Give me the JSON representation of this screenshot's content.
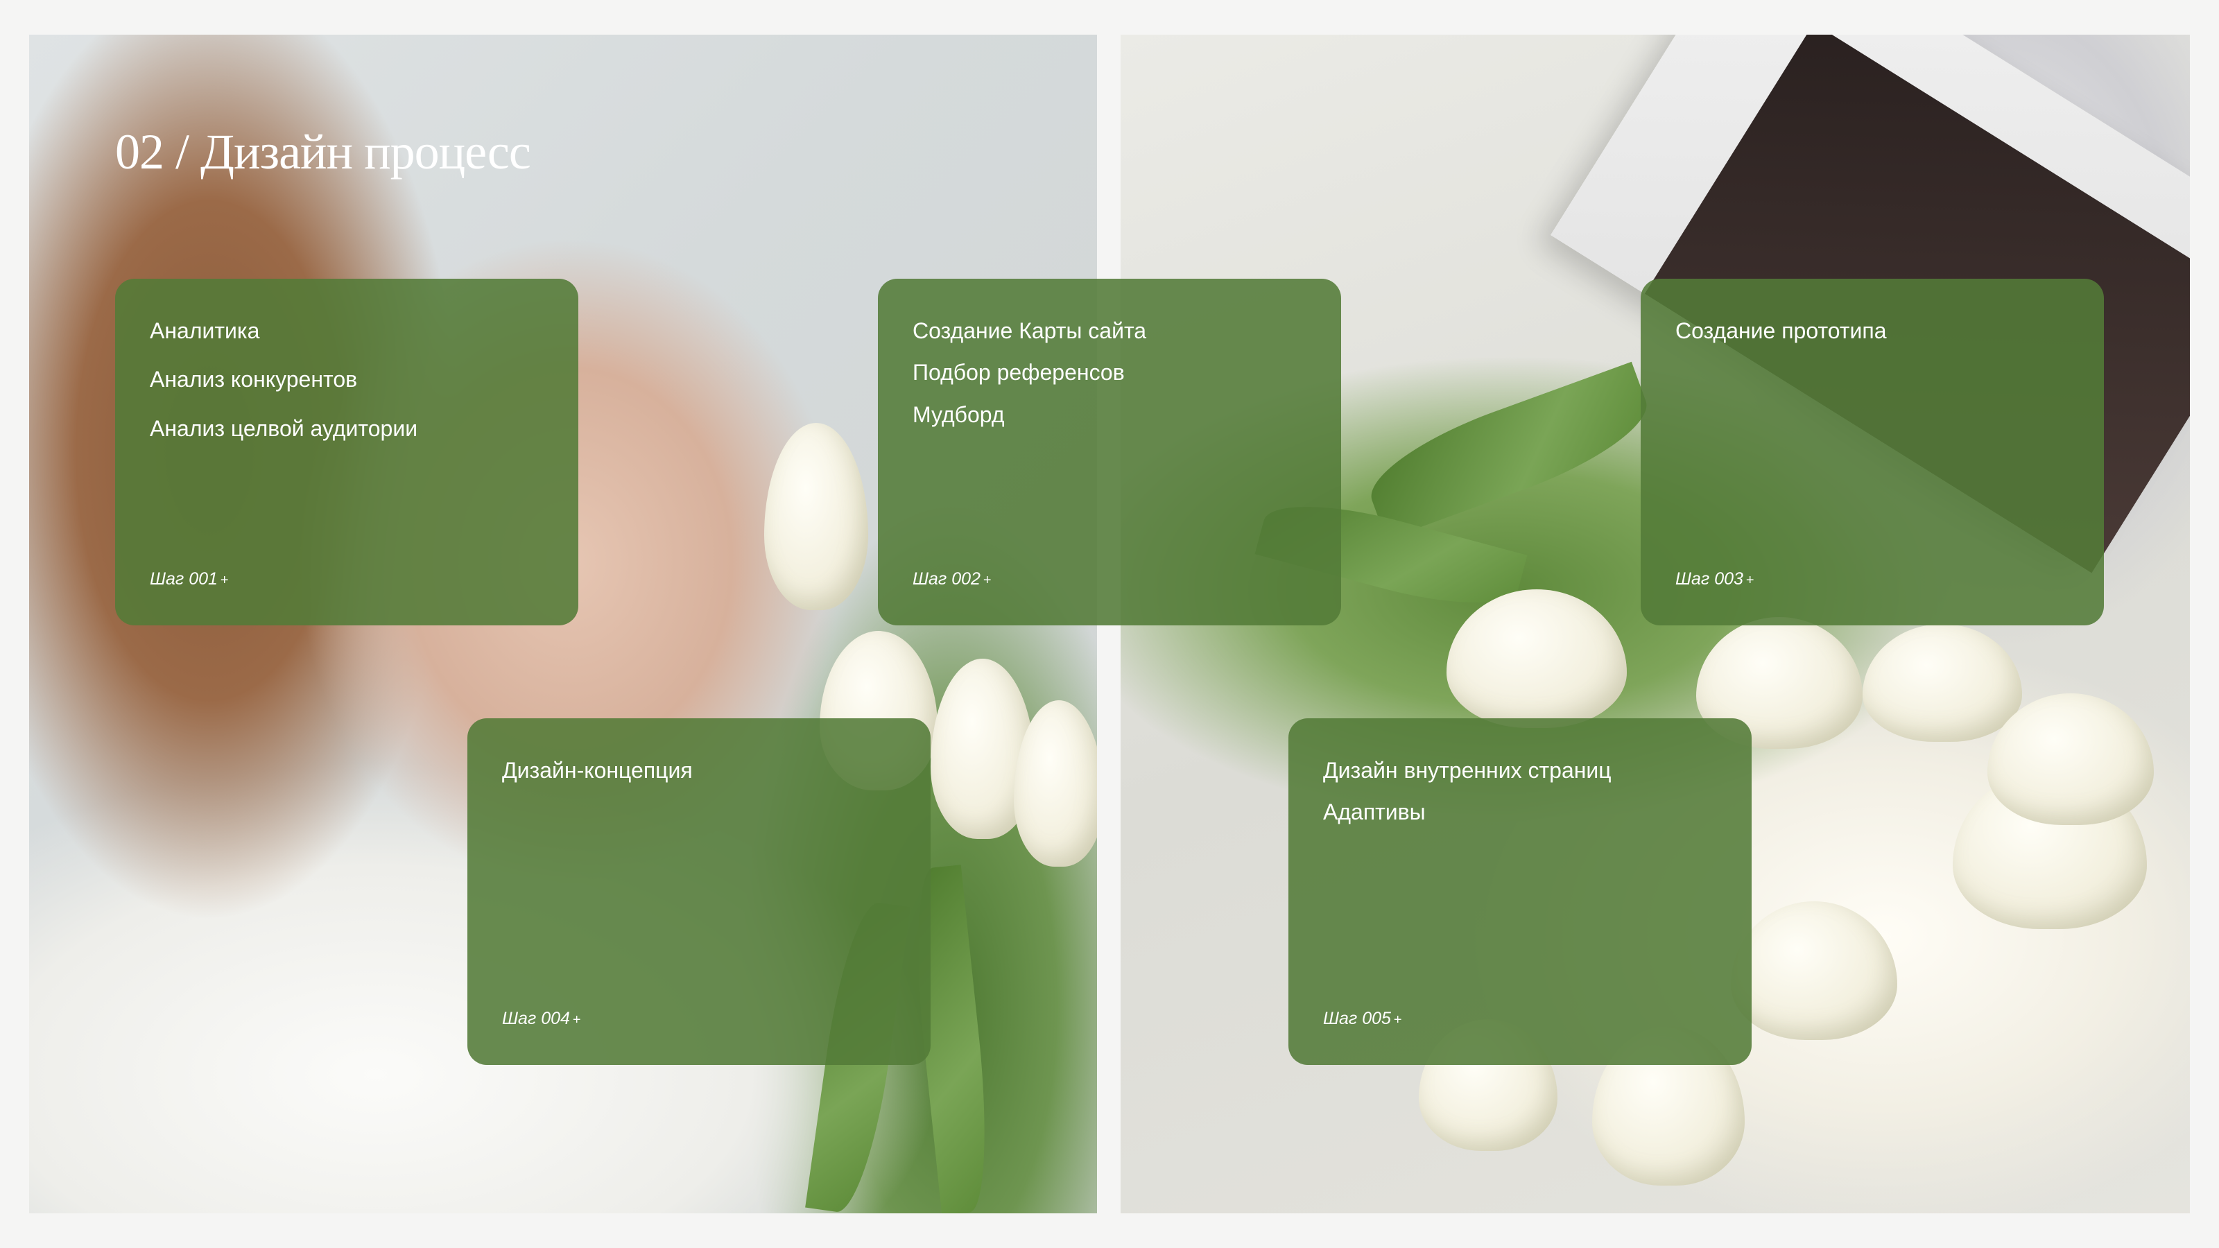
{
  "heading": {
    "title": "02 / Дизайн процесс"
  },
  "colors": {
    "card_background": "#537b38",
    "text": "#ffffff",
    "page_background": "#f5f5f4"
  },
  "images": {
    "left": "photo of woman with white tulips",
    "right": "white tulips on satin fabric with magazine"
  },
  "steps": [
    {
      "items": [
        "Аналитика",
        "Анализ конкурентов",
        "Анализ целвой аудитории"
      ],
      "label": "Шаг 001"
    },
    {
      "items": [
        "Создание Карты сайта",
        "Подбор референсов",
        "Мудборд"
      ],
      "label": "Шаг 002"
    },
    {
      "items": [
        "Создание прототипа"
      ],
      "label": "Шаг 003"
    },
    {
      "items": [
        "Дизайн-концепция"
      ],
      "label": "Шаг 004"
    },
    {
      "items": [
        "Дизайн внутренних страниц",
        "Адаптивы"
      ],
      "label": "Шаг 005"
    }
  ],
  "step_suffix": "+"
}
